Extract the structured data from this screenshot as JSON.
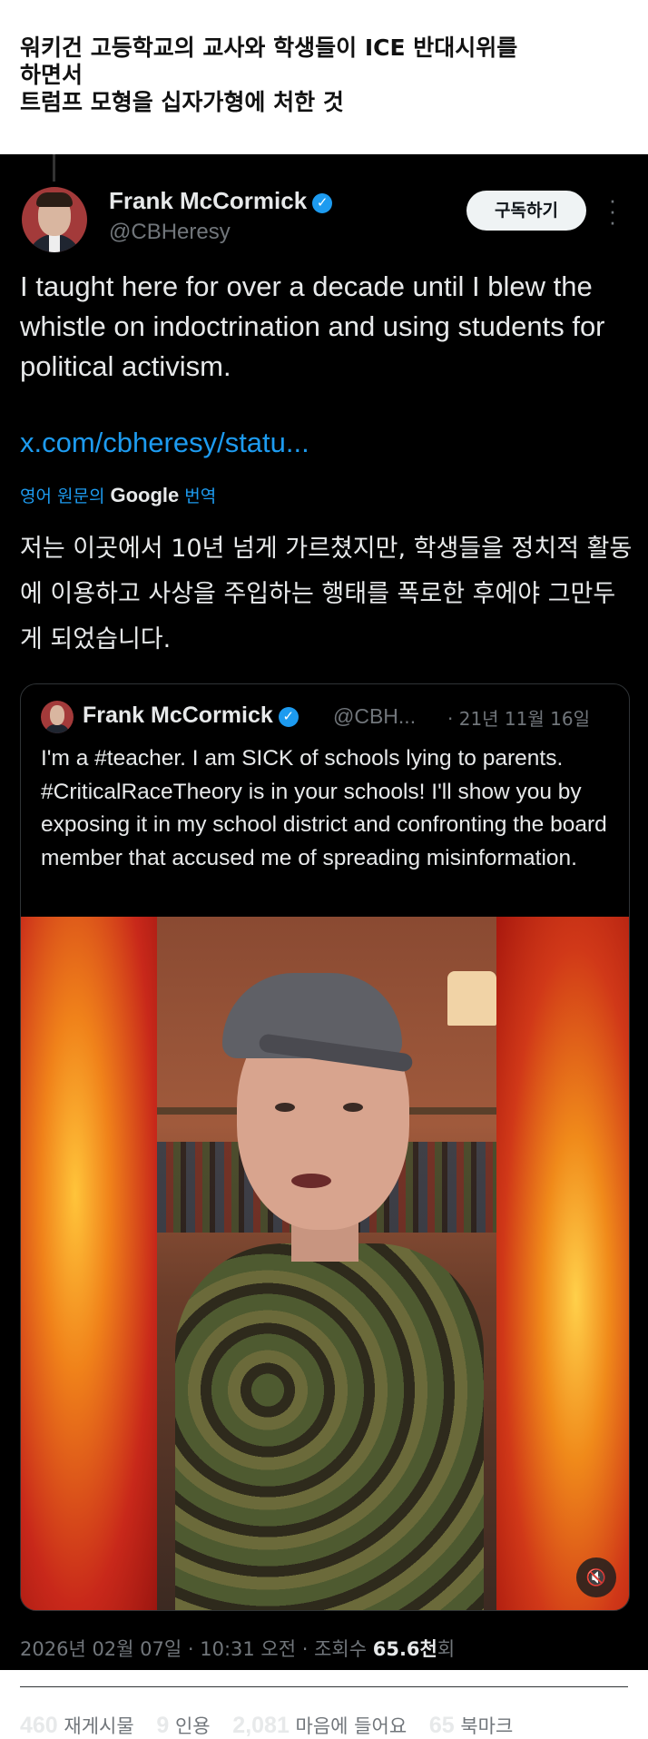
{
  "caption": {
    "line1": "워키건 고등학교의 교사와 학생들이 ICE 반대시위를",
    "line2": "하면서",
    "line3": "트럼프 모형을 십자가형에 처한 것"
  },
  "tweet": {
    "author_name": "Frank McCormick",
    "author_handle": "@CBHeresy",
    "subscribe_label": "구독하기",
    "text": "I taught here for over a decade until I blew the whistle on indoctrination and using students for political activism.",
    "link": "x.com/cbheresy/statu...",
    "translate_prefix": "영어 원문의",
    "translate_brand": "Google",
    "translate_suffix": "번역",
    "translated_text": "저는 이곳에서 10년 넘게 가르쳤지만, 학생들을 정치적 활동에 이용하고 사상을 주입하는 행태를 폭로한 후에야 그만두게 되었습니다."
  },
  "quote": {
    "author_name": "Frank McCormick",
    "author_handle": "@CBH...",
    "date": "· 21년 11월 16일",
    "text": "I'm a #teacher. I am SICK of schools lying to parents. #CriticalRaceTheory is in your schools! I'll show you by exposing it in my school district and confronting the board member that accused me of spreading misinformation."
  },
  "meta": {
    "datetime": "2026년 02월 07일 · 10:31 오전 · 조회수",
    "views": "65.6천",
    "views_suffix": "회"
  },
  "stats": {
    "reposts_num": "460",
    "reposts_label": "재게시물",
    "quotes_num": "9",
    "quotes_label": "인용",
    "likes_num": "2,081",
    "likes_label": "마음에 들어요",
    "bookmarks_num": "65",
    "bookmarks_label": "북마크"
  },
  "icons": {
    "verified": "verified-badge-icon",
    "more": "more-vertical-icon",
    "mute": "speaker-muted-icon"
  },
  "colors": {
    "accent": "#1d9bf0",
    "background": "#000000",
    "text": "#e7e9ea",
    "muted": "#71767b"
  }
}
